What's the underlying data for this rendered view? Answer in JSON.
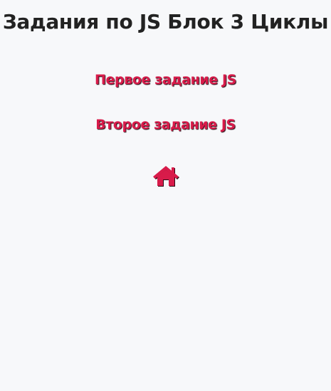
{
  "page": {
    "title": "Задания по JS Блок 3 Циклы"
  },
  "links": [
    {
      "label": "Первое задание JS"
    },
    {
      "label": "Второе задание JS"
    }
  ],
  "home": {
    "icon": "home-icon"
  },
  "colors": {
    "background": "#f7f8fa",
    "title": "#222222",
    "accent": "#d81b4a"
  }
}
